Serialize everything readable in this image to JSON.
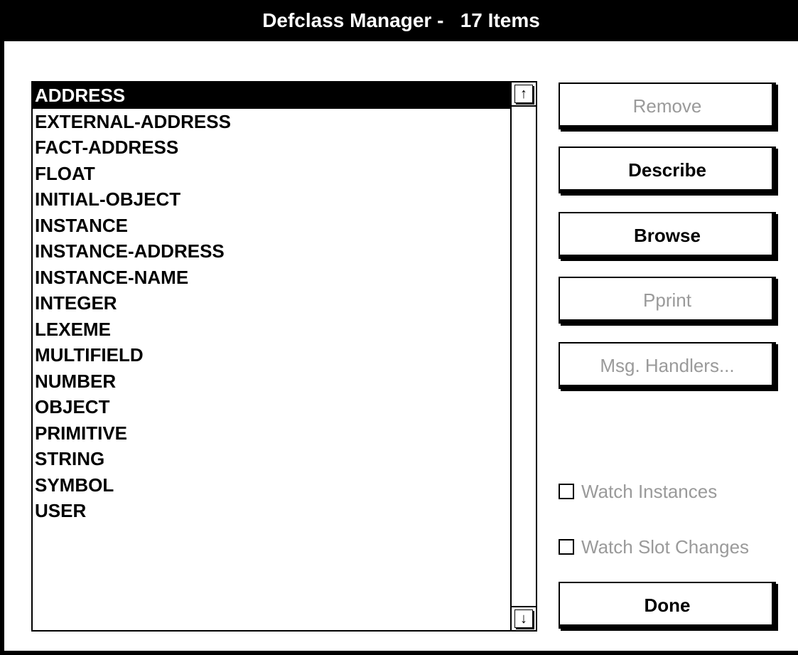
{
  "window": {
    "title": "Defclass Manager -   17 Items"
  },
  "list": {
    "items": [
      {
        "label": "ADDRESS",
        "selected": true
      },
      {
        "label": "EXTERNAL-ADDRESS"
      },
      {
        "label": "FACT-ADDRESS"
      },
      {
        "label": "FLOAT"
      },
      {
        "label": "INITIAL-OBJECT"
      },
      {
        "label": "INSTANCE"
      },
      {
        "label": "INSTANCE-ADDRESS"
      },
      {
        "label": "INSTANCE-NAME"
      },
      {
        "label": "INTEGER"
      },
      {
        "label": "LEXEME"
      },
      {
        "label": "MULTIFIELD"
      },
      {
        "label": "NUMBER"
      },
      {
        "label": "OBJECT"
      },
      {
        "label": "PRIMITIVE"
      },
      {
        "label": "STRING"
      },
      {
        "label": "SYMBOL"
      },
      {
        "label": "USER"
      }
    ],
    "scroll_up_icon": "arrow-up-icon",
    "scroll_down_icon": "arrow-down-icon"
  },
  "buttons": {
    "remove": {
      "label": "Remove",
      "enabled": false
    },
    "describe": {
      "label": "Describe",
      "enabled": true
    },
    "browse": {
      "label": "Browse",
      "enabled": true
    },
    "pprint": {
      "label": "Pprint",
      "enabled": false
    },
    "msg_handlers": {
      "label": "Msg. Handlers...",
      "enabled": false
    },
    "done": {
      "label": "Done",
      "enabled": true
    }
  },
  "checkboxes": {
    "watch_instances": {
      "label": "Watch Instances",
      "checked": false,
      "enabled": false
    },
    "watch_slot_changes": {
      "label": "Watch Slot Changes",
      "checked": false,
      "enabled": false
    }
  },
  "colors": {
    "selection": "#000000",
    "disabled_text": "#9a9a9a"
  }
}
